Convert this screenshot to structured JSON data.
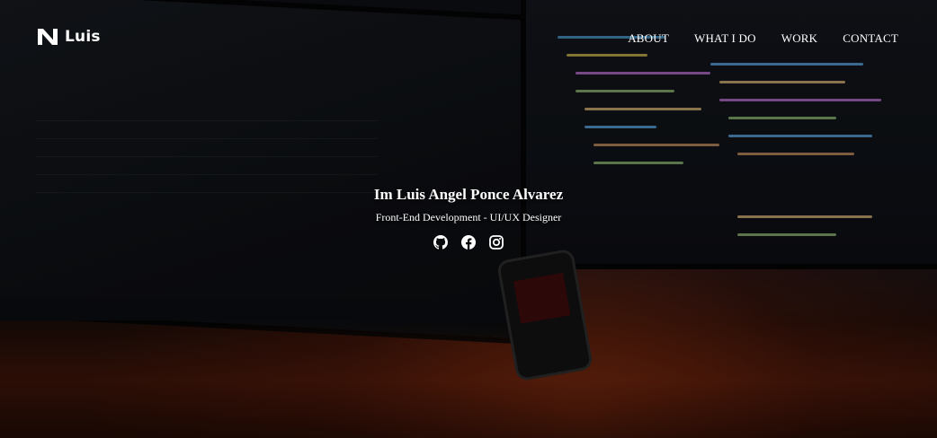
{
  "brand": {
    "logo_icon": "n-logo-icon",
    "name": "Luis"
  },
  "nav": {
    "items": [
      {
        "label": "ABOUT"
      },
      {
        "label": "WHAT I DO"
      },
      {
        "label": "WORK"
      },
      {
        "label": "CONTACT"
      }
    ]
  },
  "hero": {
    "title": "Im Luis Angel Ponce Alvarez",
    "subtitle": "Front-End Development - UI/UX Designer",
    "background": "desk-setup-photo"
  },
  "socials": [
    {
      "icon": "github-icon"
    },
    {
      "icon": "facebook-icon"
    },
    {
      "icon": "instagram-icon"
    }
  ],
  "colors": {
    "text": "#ffffff",
    "background": "#0c0f14",
    "accent_glow": "#b43c14"
  }
}
